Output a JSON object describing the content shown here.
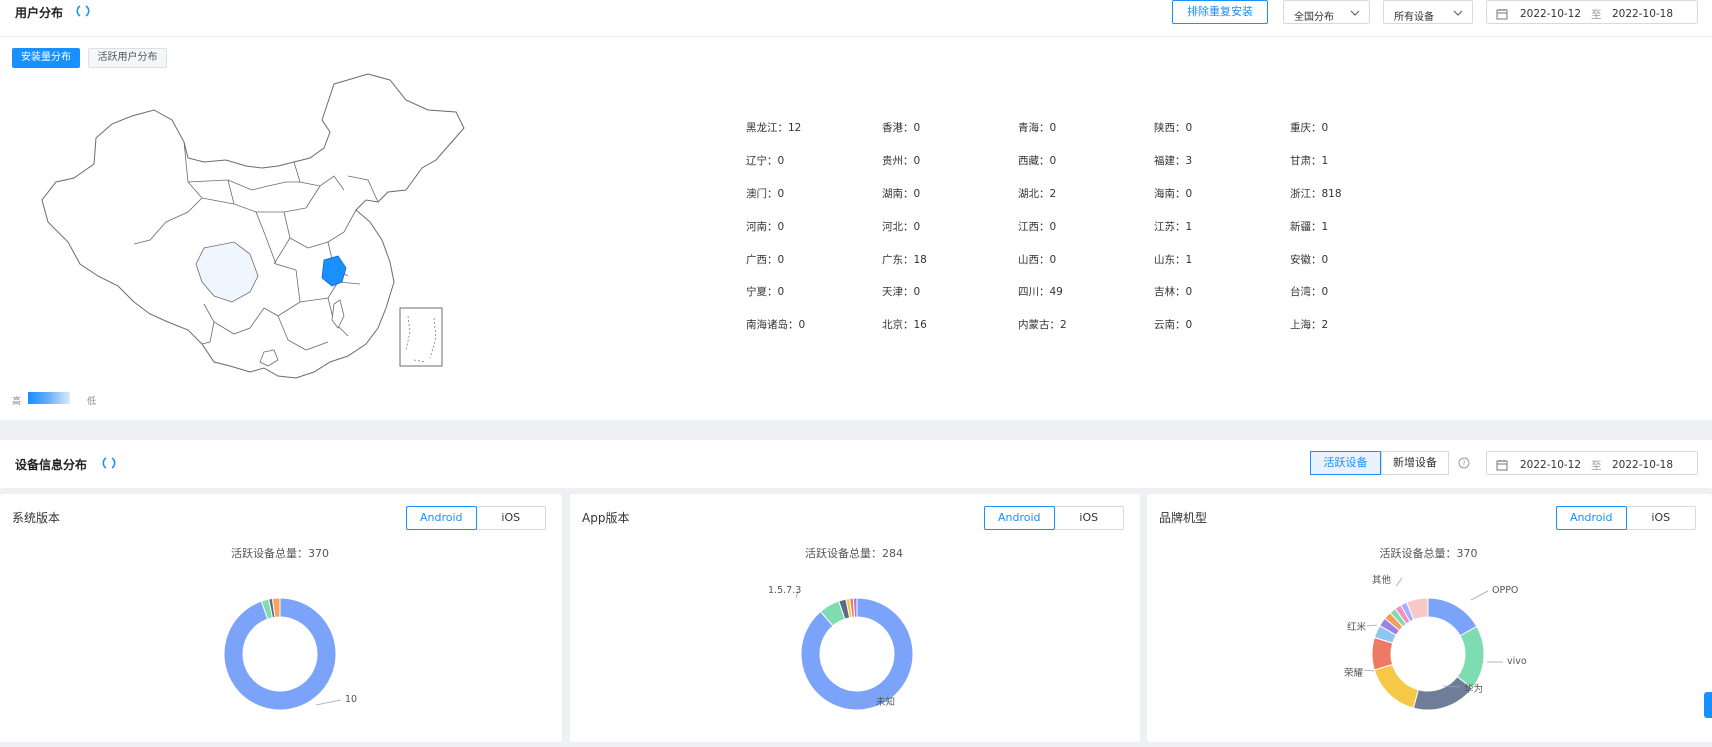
{
  "user_distribution": {
    "title": "用户分布",
    "dedupe_button": "排除重复安装",
    "region_select": "全国分布",
    "device_select": "所有设备",
    "date_start": "2022-10-12",
    "date_sep": "至",
    "date_end": "2022-10-18",
    "tabs": [
      "安装量分布",
      "活跃用户分布"
    ],
    "active_tab": 0,
    "legend_high": "高",
    "legend_low": "低",
    "highlight_color": "#1890ff",
    "light_color": "#f0f6fd",
    "stats": [
      [
        "黑龙江：12",
        "香港：0",
        "青海：0",
        "陕西：0",
        "重庆：0"
      ],
      [
        "辽宁：0",
        "贵州：0",
        "西藏：0",
        "福建：3",
        "甘肃：1"
      ],
      [
        "澳门：0",
        "湖南：0",
        "湖北：2",
        "海南：0",
        "浙江：818"
      ],
      [
        "河南：0",
        "河北：0",
        "江西：0",
        "江苏：1",
        "新疆：1"
      ],
      [
        "广西：0",
        "广东：18",
        "山西：0",
        "山东：1",
        "安徽：0"
      ],
      [
        "宁夏：0",
        "天津：0",
        "四川：49",
        "吉林：0",
        "台湾：0"
      ],
      [
        "南海诸岛：0",
        "北京：16",
        "内蒙古：2",
        "云南：0",
        "上海：2"
      ]
    ]
  },
  "device_info": {
    "title": "设备信息分布",
    "tab_active": "活跃设备",
    "tab_new": "新增设备",
    "help_icon": "question-circle-icon",
    "date_start": "2022-10-12",
    "date_sep": "至",
    "date_end": "2022-10-18"
  },
  "cards": [
    {
      "title": "系统版本",
      "seg_android": "Android",
      "seg_ios": "iOS",
      "total": "活跃设备总量：370",
      "chart_data": {
        "type": "pie",
        "donut": true,
        "categories": [
          "10",
          "",
          "",
          ""
        ],
        "values": [
          350,
          8,
          4,
          8
        ],
        "colors": [
          "#7aa3f9",
          "#7ddcb0",
          "#5f6b86",
          "#f9a45a"
        ]
      },
      "labels": [
        "10"
      ]
    },
    {
      "title": "App版本",
      "seg_android": "Android",
      "seg_ios": "iOS",
      "total": "活跃设备总量：284",
      "chart_data": {
        "type": "pie",
        "donut": true,
        "categories": [
          "未知",
          "1.5.7.3",
          "",
          "",
          "",
          ""
        ],
        "values": [
          252,
          17,
          6,
          3,
          3,
          3
        ],
        "colors": [
          "#7aa3f9",
          "#7ddcb0",
          "#5f6b86",
          "#f7c747",
          "#ee7a66",
          "#9d80e6"
        ]
      },
      "labels": [
        "未知",
        "1.5.7.3"
      ]
    },
    {
      "title": "品牌机型",
      "seg_android": "Android",
      "seg_ios": "iOS",
      "total": "活跃设备总量：370",
      "chart_data": {
        "type": "pie",
        "donut": true,
        "categories": [
          "OPPO",
          "vivo",
          "华为",
          "荣耀",
          "红米",
          "",
          "",
          "",
          "",
          "",
          "",
          "其他"
        ],
        "values": [
          54,
          60,
          60,
          52,
          30,
          12,
          8,
          7,
          6,
          6,
          6,
          20
        ],
        "colors": [
          "#7aa3f9",
          "#7ddcb0",
          "#6f7d99",
          "#f7c747",
          "#ee7a66",
          "#8ec7f2",
          "#9d80e6",
          "#f59c5c",
          "#7ddcb0",
          "#f68ec0",
          "#a7b0ff",
          "#f6c9c6"
        ]
      },
      "labels": [
        "OPPO",
        "vivo",
        "华为",
        "荣耀",
        "红米",
        "其他"
      ]
    }
  ]
}
